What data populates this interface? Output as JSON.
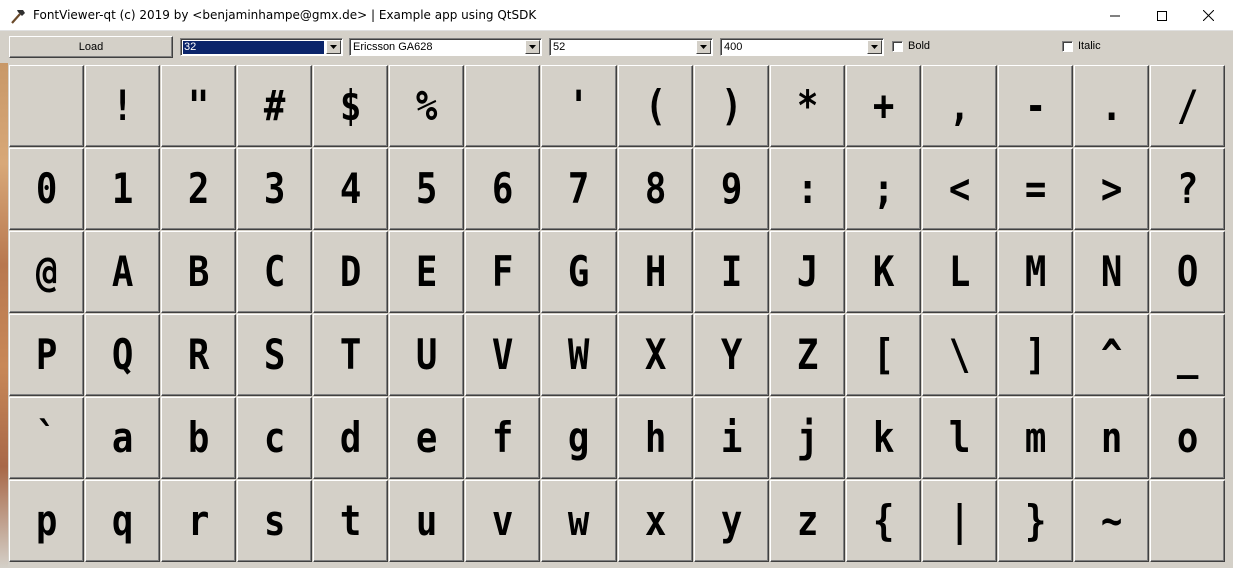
{
  "window": {
    "title": "FontViewer-qt (c) 2019 by <benjaminhampe@gmx.de> | Example app using QtSDK",
    "icon": "hammer-icon",
    "controls": [
      "minimize-icon",
      "maximize-icon",
      "close-icon"
    ]
  },
  "toolbar": {
    "load_label": "Load",
    "char_code": "32",
    "font_family": "Ericsson GA628",
    "font_size": "52",
    "font_weight": "400",
    "bold_label": "Bold",
    "bold_checked": false,
    "italic_label": "Italic",
    "italic_checked": false
  },
  "glyphs": [
    " ",
    "!",
    "\"",
    "#",
    "$",
    "%",
    " ",
    "'",
    "(",
    ")",
    "*",
    "+",
    ",",
    "-",
    ".",
    "/",
    "0",
    "1",
    "2",
    "3",
    "4",
    "5",
    "6",
    "7",
    "8",
    "9",
    ":",
    ";",
    "<",
    "=",
    ">",
    "?",
    "@",
    "A",
    "B",
    "C",
    "D",
    "E",
    "F",
    "G",
    "H",
    "I",
    "J",
    "K",
    "L",
    "M",
    "N",
    "O",
    "P",
    "Q",
    "R",
    "S",
    "T",
    "U",
    "V",
    "W",
    "X",
    "Y",
    "Z",
    "[",
    "\\",
    "]",
    "^",
    "_",
    "`",
    "a",
    "b",
    "c",
    "d",
    "e",
    "f",
    "g",
    "h",
    "i",
    "j",
    "k",
    "l",
    "m",
    "n",
    "o",
    "p",
    "q",
    "r",
    "s",
    "t",
    "u",
    "v",
    "w",
    "x",
    "y",
    "z",
    "{",
    "|",
    "}",
    "~",
    " "
  ]
}
